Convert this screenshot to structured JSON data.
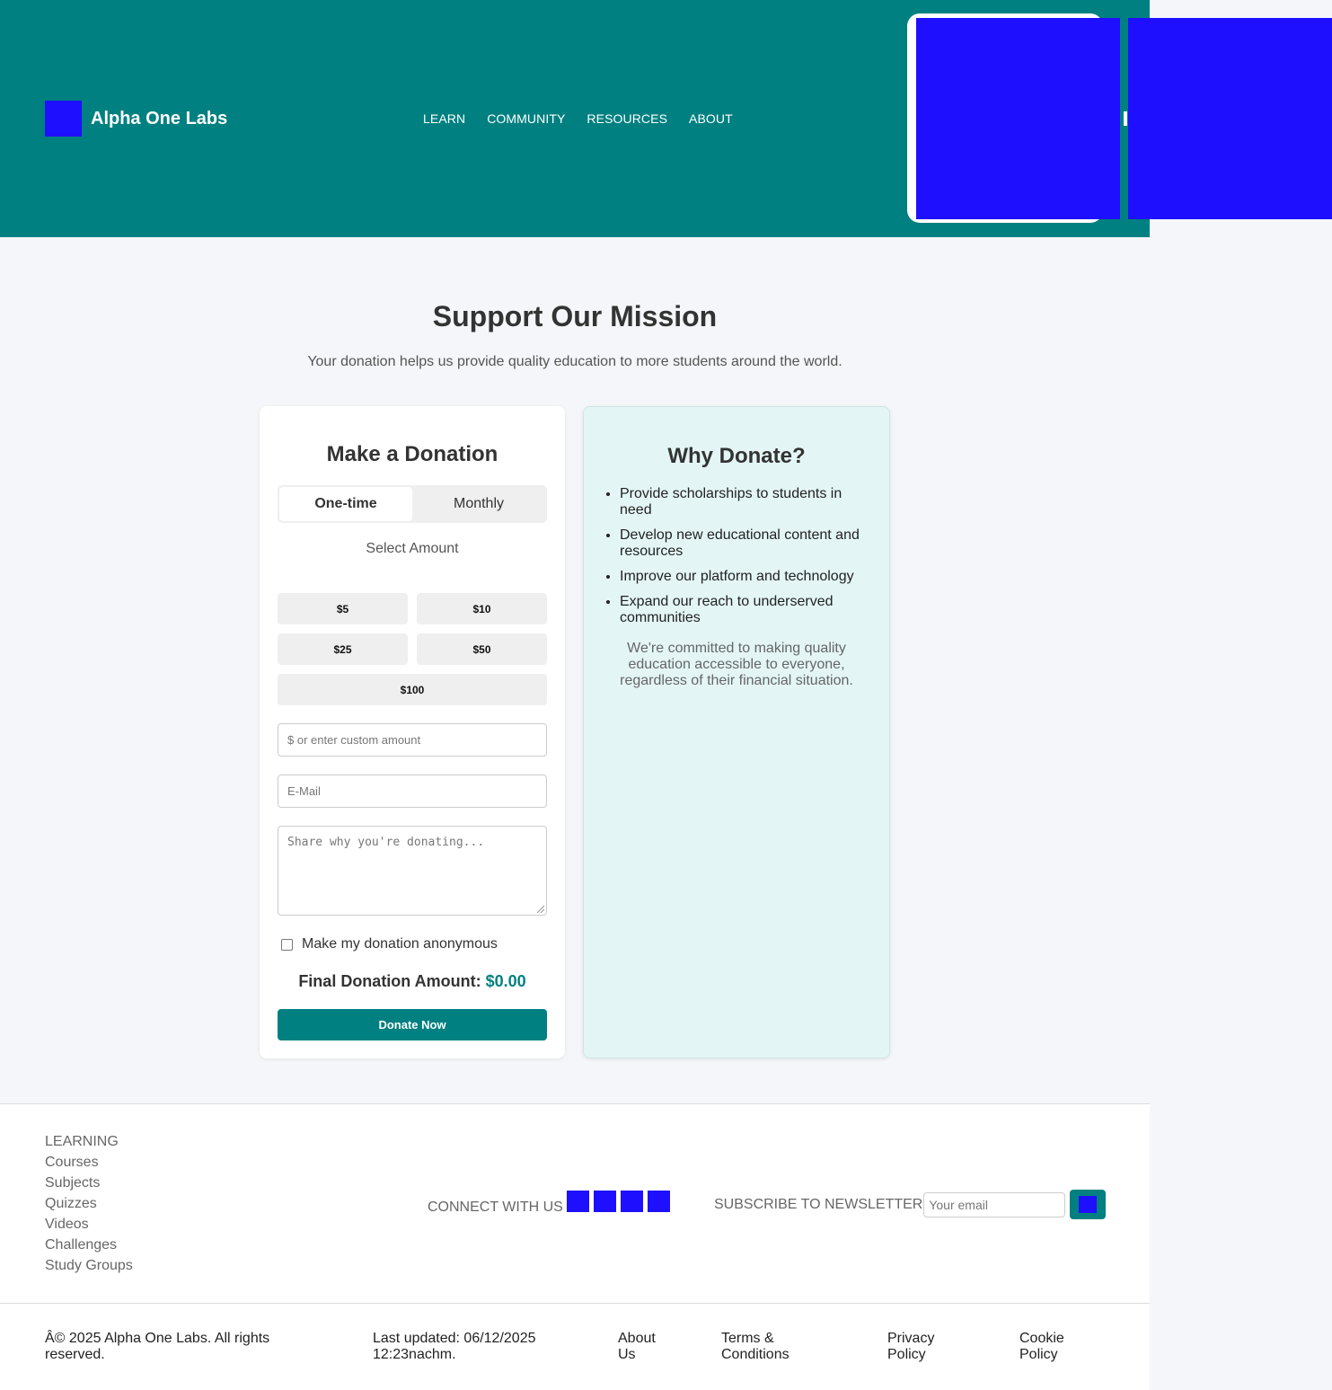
{
  "header": {
    "brand": "Alpha One Labs",
    "nav": [
      "LEARN",
      "COMMUNITY",
      "RESOURCES",
      "ABOUT"
    ]
  },
  "main": {
    "title": "Support Our Mission",
    "subtitle": "Your donation helps us provide quality education to more students around the world."
  },
  "donation": {
    "heading": "Make a Donation",
    "tab_onetime": "One-time",
    "tab_monthly": "Monthly",
    "select_amount": "Select Amount",
    "amounts": [
      "$5",
      "$10",
      "$25",
      "$50",
      "$100"
    ],
    "custom_placeholder": "$ or enter custom amount",
    "email_placeholder": "E-Mail",
    "message_placeholder": "Share why you're donating...",
    "anonymous_label": "Make my donation anonymous",
    "final_label": "Final Donation Amount:",
    "final_value": "$0.00",
    "donate_button": "Donate Now"
  },
  "why": {
    "heading": "Why Donate?",
    "items": [
      "Provide scholarships to students in need",
      "Develop new educational content and resources",
      "Improve our platform and technology",
      "Expand our reach to underserved communities"
    ],
    "note": "We're committed to making quality education accessible to everyone, regardless of their financial situation."
  },
  "footer": {
    "learning_heading": "LEARNING",
    "learning_links": [
      "Courses",
      "Subjects",
      "Quizzes",
      "Videos",
      "Challenges",
      "Study Groups"
    ],
    "connect_label": "CONNECT WITH US",
    "subscribe_label": "SUBSCRIBE TO NEWSLETTER",
    "subscribe_placeholder": "Your email",
    "copyright": "Â© 2025 Alpha One Labs. All rights reserved.",
    "last_updated": "Last updated: 06/12/2025 12:23nachm.",
    "links": [
      "About Us",
      "Terms & Conditions",
      "Privacy Policy",
      "Cookie Policy"
    ]
  },
  "colors": {
    "primary": "#008080",
    "placeholder_block": "#1e10ff",
    "bg": "#f4f6f9",
    "why_bg": "#e3f6f5"
  }
}
